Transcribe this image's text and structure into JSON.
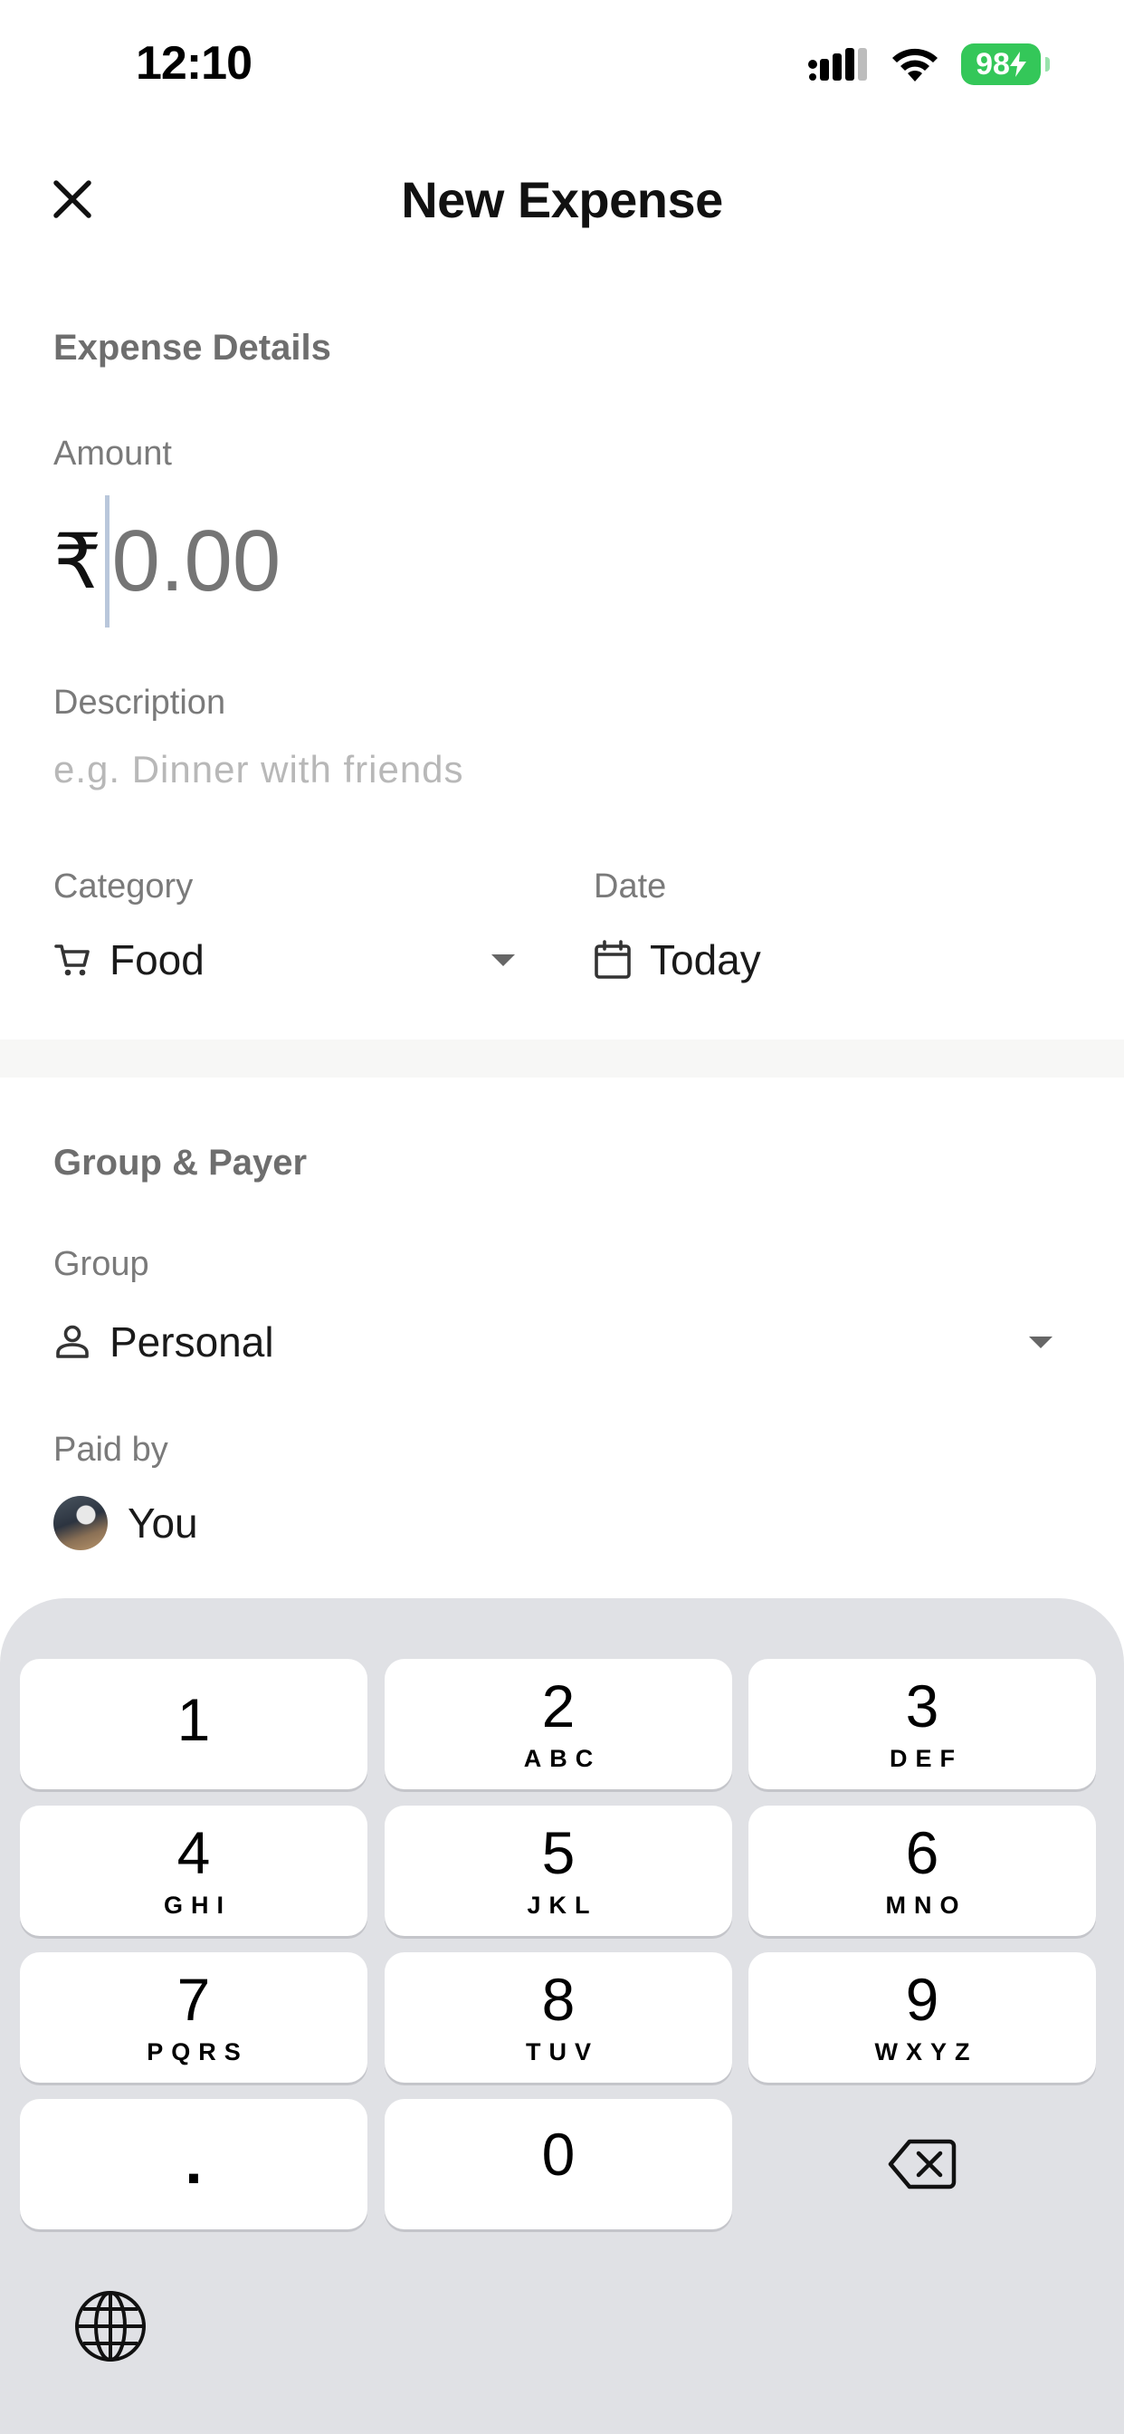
{
  "status_bar": {
    "time": "12:10",
    "battery": "98",
    "icons": [
      "cellular-signal-icon",
      "wifi-icon",
      "battery-charging-icon"
    ],
    "battery_color": "#34c759"
  },
  "header": {
    "title": "New Expense",
    "close_icon": "close-icon"
  },
  "expense_details": {
    "section_title": "Expense Details",
    "amount": {
      "label": "Amount",
      "currency_symbol": "₹",
      "placeholder": "0.00",
      "value": ""
    },
    "description": {
      "label": "Description",
      "placeholder": "e.g. Dinner with friends"
    },
    "category": {
      "label": "Category",
      "value": "Food",
      "icon": "cart-icon"
    },
    "date": {
      "label": "Date",
      "value": "Today",
      "icon": "calendar-icon"
    }
  },
  "group_payer": {
    "section_title": "Group & Payer",
    "group": {
      "label": "Group",
      "value": "Personal",
      "icon": "person-icon"
    },
    "paid_by": {
      "label": "Paid by",
      "value": "You"
    }
  },
  "keyboard": {
    "keys": [
      {
        "digit": "1",
        "letters": ""
      },
      {
        "digit": "2",
        "letters": "ABC"
      },
      {
        "digit": "3",
        "letters": "DEF"
      },
      {
        "digit": "4",
        "letters": "GHI"
      },
      {
        "digit": "5",
        "letters": "JKL"
      },
      {
        "digit": "6",
        "letters": "MNO"
      },
      {
        "digit": "7",
        "letters": "PQRS"
      },
      {
        "digit": "8",
        "letters": "TUV"
      },
      {
        "digit": "9",
        "letters": "WXYZ"
      },
      {
        "digit": ".",
        "letters": ""
      },
      {
        "digit": "0",
        "letters": ""
      }
    ],
    "background_color": "#e0e1e5"
  }
}
